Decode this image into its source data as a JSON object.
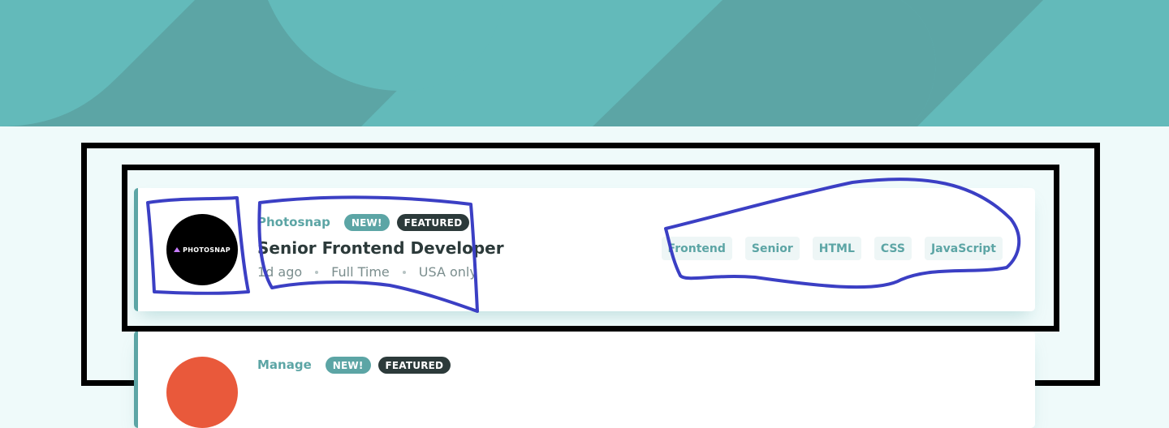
{
  "colors": {
    "primary": "#5CA5A5",
    "background": "#EFFAFA",
    "dark": "#2C3A3A",
    "annotation_stroke": "#3B3FC4"
  },
  "jobs": [
    {
      "logo_text": "PHOTOSNAP",
      "company": "Photosnap",
      "new_label": "NEW!",
      "featured_label": "FEATURED",
      "position": "Senior Frontend Developer",
      "posted": "1d ago",
      "contract": "Full Time",
      "location": "USA only",
      "tags": [
        "Frontend",
        "Senior",
        "HTML",
        "CSS",
        "JavaScript"
      ]
    },
    {
      "company": "Manage",
      "new_label": "NEW!",
      "featured_label": "FEATURED"
    }
  ]
}
